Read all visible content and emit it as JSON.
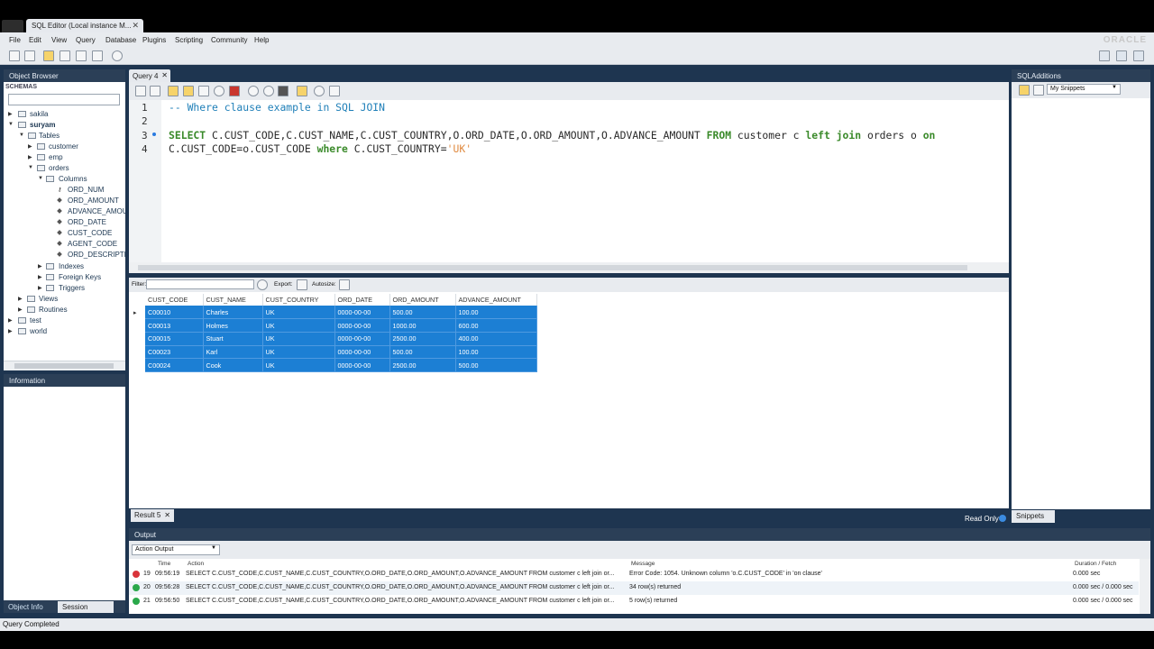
{
  "window": {
    "tab_title": "SQL Editor (Local instance M...",
    "close": "✕",
    "brand": "ORACLE"
  },
  "menu": [
    "File",
    "Edit",
    "View",
    "Query",
    "Database",
    "Plugins",
    "Scripting",
    "Community",
    "Help"
  ],
  "object_browser": {
    "title": "Object Browser",
    "schemas_label": "SCHEMAS",
    "tree": {
      "sakila": "sakila",
      "suryam": "suryam",
      "tables": "Tables",
      "customer": "customer",
      "emp": "emp",
      "orders": "orders",
      "columns": "Columns",
      "cols": [
        "ORD_NUM",
        "ORD_AMOUNT",
        "ADVANCE_AMOU",
        "ORD_DATE",
        "CUST_CODE",
        "AGENT_CODE",
        "ORD_DESCRIPTIO"
      ],
      "indexes": "Indexes",
      "foreign_keys": "Foreign Keys",
      "triggers": "Triggers",
      "views": "Views",
      "routines": "Routines",
      "test": "test",
      "world": "world"
    }
  },
  "information": {
    "title": "Information"
  },
  "left_tabs": {
    "object_info": "Object Info",
    "session": "Session"
  },
  "editor": {
    "tab_label": "Query 4",
    "line_numbers": [
      "1",
      "2",
      "3",
      "4"
    ],
    "line1": "-- Where clause example in SQL JOIN",
    "line3": {
      "kw_select": "SELECT",
      "cols": " C.CUST_CODE,C.CUST_NAME,C.CUST_COUNTRY,O.ORD_DATE,O.ORD_AMOUNT,O.ADVANCE_AMOUNT ",
      "kw_from": "FROM",
      "mid": " customer c ",
      "kw_left": "left",
      "sp1": " ",
      "kw_join": "join",
      "tail": " orders o ",
      "kw_on": "on"
    },
    "line4": {
      "cond": "C.CUST_CODE=o.CUST_CODE ",
      "kw_where": "where",
      "col": " C.CUST_COUNTRY=",
      "str": "'UK'"
    }
  },
  "results_toolbar": {
    "filter": "Filter:",
    "export": "Export:",
    "autosize": "Autosize:"
  },
  "result_grid": {
    "columns": [
      "CUST_CODE",
      "CUST_NAME",
      "CUST_COUNTRY",
      "ORD_DATE",
      "ORD_AMOUNT",
      "ADVANCE_AMOUNT"
    ],
    "rows": [
      [
        "C00010",
        "Charles",
        "UK",
        "0000-00-00",
        "500.00",
        "100.00"
      ],
      [
        "C00013",
        "Holmes",
        "UK",
        "0000-00-00",
        "1000.00",
        "600.00"
      ],
      [
        "C00015",
        "Stuart",
        "UK",
        "0000-00-00",
        "2500.00",
        "400.00"
      ],
      [
        "C00023",
        "Karl",
        "UK",
        "0000-00-00",
        "500.00",
        "100.00"
      ],
      [
        "C00024",
        "Cook",
        "UK",
        "0000-00-00",
        "2500.00",
        "500.00"
      ]
    ]
  },
  "result_tab": {
    "label": "Result 5",
    "read_only": "Read Only"
  },
  "sql_additions": {
    "title": "SQLAdditions",
    "snippets_select": "My Snippets",
    "tab": "Snippets"
  },
  "output": {
    "title": "Output",
    "select": "Action Output",
    "headers": {
      "time": "Time",
      "action": "Action",
      "message": "Message",
      "duration": "Duration / Fetch"
    },
    "rows": [
      {
        "num": "19",
        "time": "09:56:19",
        "action": "SELECT C.CUST_CODE,C.CUST_NAME,C.CUST_COUNTRY,O.ORD_DATE,O.ORD_AMOUNT,O.ADVANCE_AMOUNT FROM customer c left join or...",
        "message": "Error Code: 1054. Unknown column 'o.C.CUST_CODE' in 'on clause'",
        "duration": "0.000 sec",
        "status": "error"
      },
      {
        "num": "20",
        "time": "09:56:28",
        "action": "SELECT C.CUST_CODE,C.CUST_NAME,C.CUST_COUNTRY,O.ORD_DATE,O.ORD_AMOUNT,O.ADVANCE_AMOUNT FROM customer c left join or...",
        "message": "34 row(s) returned",
        "duration": "0.000 sec / 0.000 sec",
        "status": "ok"
      },
      {
        "num": "21",
        "time": "09:56:50",
        "action": "SELECT C.CUST_CODE,C.CUST_NAME,C.CUST_COUNTRY,O.ORD_DATE,O.ORD_AMOUNT,O.ADVANCE_AMOUNT FROM customer c left join or...",
        "message": "5 row(s) returned",
        "duration": "0.000 sec / 0.000 sec",
        "status": "ok"
      }
    ]
  },
  "status_bar": "Query Completed",
  "colors": {
    "accent": "#1c7fd4",
    "keyword": "#3a8a2a",
    "comment": "#1f7fb8",
    "string": "#e08a40",
    "error": "#d9343a",
    "ok": "#2aa84a"
  }
}
